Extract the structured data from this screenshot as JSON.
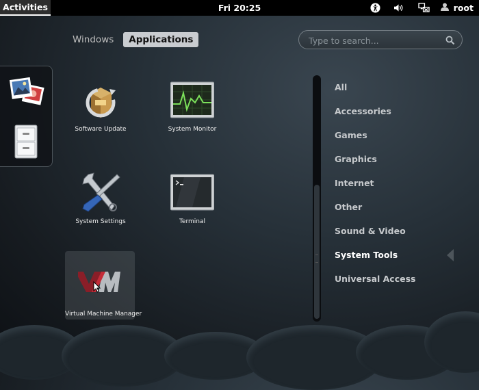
{
  "topbar": {
    "activities": "Activities",
    "clock": "Fri 20:25",
    "user": "root",
    "icons": [
      "accessibility-icon",
      "volume-icon",
      "network-icon",
      "user-icon"
    ]
  },
  "view_selector": {
    "windows": "Windows",
    "applications": "Applications",
    "active": "Applications"
  },
  "search": {
    "placeholder": "Type to search...",
    "value": ""
  },
  "dash": {
    "favorites": [
      "photo-viewer-icon",
      "file-cabinet-icon"
    ]
  },
  "apps": [
    {
      "label": "Software Update",
      "icon": "software-update-icon"
    },
    {
      "label": "System Monitor",
      "icon": "system-monitor-icon"
    },
    {
      "label": "System Settings",
      "icon": "system-settings-icon"
    },
    {
      "label": "Terminal",
      "icon": "terminal-icon"
    },
    {
      "label": "Virtual Machine Manager",
      "icon": "virt-manager-icon",
      "hovered": true
    }
  ],
  "categories": [
    {
      "label": "All"
    },
    {
      "label": "Accessories"
    },
    {
      "label": "Games"
    },
    {
      "label": "Graphics"
    },
    {
      "label": "Internet"
    },
    {
      "label": "Other"
    },
    {
      "label": "Sound & Video"
    },
    {
      "label": "System Tools",
      "selected": true
    },
    {
      "label": "Universal Access"
    }
  ],
  "colors": {
    "topbar": "#000000",
    "active_tab": "#c9ccd0",
    "background": "#263038"
  }
}
